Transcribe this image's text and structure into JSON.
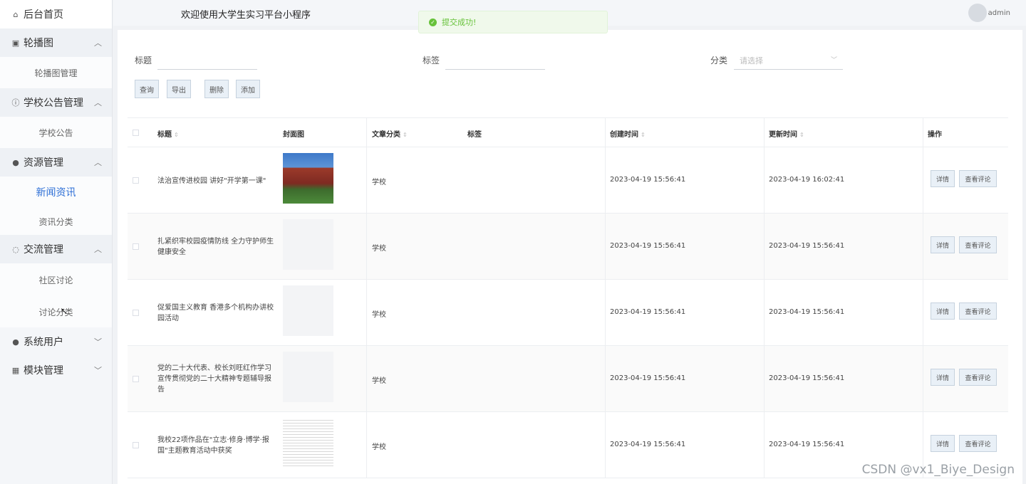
{
  "sidebar": {
    "home": "后台首页",
    "groups": [
      {
        "label": "轮播图",
        "icon": "image-icon",
        "subs": [
          "轮播图管理"
        ]
      },
      {
        "label": "学校公告管理",
        "icon": "info-icon",
        "subs": [
          "学校公告"
        ]
      },
      {
        "label": "资源管理",
        "icon": "globe-icon",
        "subs": [
          "新闻资讯",
          "资讯分类"
        ]
      },
      {
        "label": "交流管理",
        "icon": "chat-icon",
        "subs": [
          "社区讨论",
          "讨论分类"
        ]
      },
      {
        "label": "系统用户",
        "icon": "user-icon",
        "subs": []
      },
      {
        "label": "模块管理",
        "icon": "grid-icon",
        "subs": []
      }
    ],
    "active": "新闻资讯"
  },
  "header": {
    "welcome": "欢迎使用大学生实习平台小程序",
    "user": "admin"
  },
  "toast": {
    "message": "提交成功!"
  },
  "search": {
    "title_label": "标题",
    "tag_label": "标签",
    "category_label": "分类",
    "category_placeholder": "请选择"
  },
  "buttons": {
    "query": "查询",
    "export": "导出",
    "delete": "删除",
    "add": "添加"
  },
  "table": {
    "headers": {
      "title": "标题",
      "cover": "封面图",
      "category": "文章分类",
      "tags": "标签",
      "created": "创建时间",
      "updated": "更新时间",
      "actions": "操作"
    },
    "rows": [
      {
        "title": "法治宣传进校园 讲好\"开学第一课\"",
        "category": "学校",
        "created": "2023-04-19 15:56:41",
        "updated": "2023-04-19 16:02:41"
      },
      {
        "title": "扎紧织牢校园疫情防线 全力守护师生健康安全",
        "category": "学校",
        "created": "2023-04-19 15:56:41",
        "updated": "2023-04-19 15:56:41"
      },
      {
        "title": "促爱国主义教育 香港多个机构办讲校园活动",
        "category": "学校",
        "created": "2023-04-19 15:56:41",
        "updated": "2023-04-19 15:56:41"
      },
      {
        "title": "党的二十大代表、校长刘旺红作学习宣传贯彻党的二十大精神专题辅导报告",
        "category": "学校",
        "created": "2023-04-19 15:56:41",
        "updated": "2023-04-19 15:56:41"
      },
      {
        "title": "我校22项作品在\"立志·修身·博学·报国\"主题教育活动中获奖",
        "category": "学校",
        "created": "2023-04-19 15:56:41",
        "updated": "2023-04-19 15:56:41"
      }
    ],
    "row_actions": {
      "detail": "详情",
      "comments": "查看评论"
    }
  },
  "watermark": "CSDN @vx1_Biye_Design"
}
